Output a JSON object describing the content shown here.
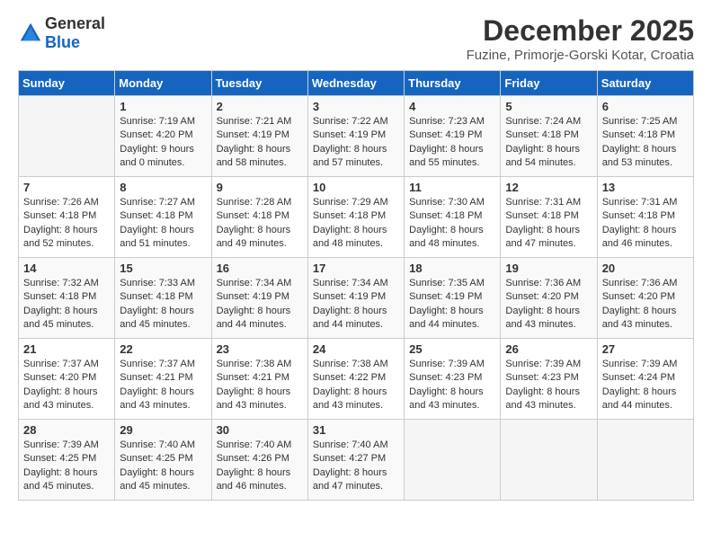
{
  "header": {
    "logo_general": "General",
    "logo_blue": "Blue",
    "title": "December 2025",
    "subtitle": "Fuzine, Primorje-Gorski Kotar, Croatia"
  },
  "calendar": {
    "days_of_week": [
      "Sunday",
      "Monday",
      "Tuesday",
      "Wednesday",
      "Thursday",
      "Friday",
      "Saturday"
    ],
    "weeks": [
      [
        {
          "day": "",
          "sunrise": "",
          "sunset": "",
          "daylight": ""
        },
        {
          "day": "1",
          "sunrise": "Sunrise: 7:19 AM",
          "sunset": "Sunset: 4:20 PM",
          "daylight": "Daylight: 9 hours and 0 minutes."
        },
        {
          "day": "2",
          "sunrise": "Sunrise: 7:21 AM",
          "sunset": "Sunset: 4:19 PM",
          "daylight": "Daylight: 8 hours and 58 minutes."
        },
        {
          "day": "3",
          "sunrise": "Sunrise: 7:22 AM",
          "sunset": "Sunset: 4:19 PM",
          "daylight": "Daylight: 8 hours and 57 minutes."
        },
        {
          "day": "4",
          "sunrise": "Sunrise: 7:23 AM",
          "sunset": "Sunset: 4:19 PM",
          "daylight": "Daylight: 8 hours and 55 minutes."
        },
        {
          "day": "5",
          "sunrise": "Sunrise: 7:24 AM",
          "sunset": "Sunset: 4:18 PM",
          "daylight": "Daylight: 8 hours and 54 minutes."
        },
        {
          "day": "6",
          "sunrise": "Sunrise: 7:25 AM",
          "sunset": "Sunset: 4:18 PM",
          "daylight": "Daylight: 8 hours and 53 minutes."
        }
      ],
      [
        {
          "day": "7",
          "sunrise": "Sunrise: 7:26 AM",
          "sunset": "Sunset: 4:18 PM",
          "daylight": "Daylight: 8 hours and 52 minutes."
        },
        {
          "day": "8",
          "sunrise": "Sunrise: 7:27 AM",
          "sunset": "Sunset: 4:18 PM",
          "daylight": "Daylight: 8 hours and 51 minutes."
        },
        {
          "day": "9",
          "sunrise": "Sunrise: 7:28 AM",
          "sunset": "Sunset: 4:18 PM",
          "daylight": "Daylight: 8 hours and 49 minutes."
        },
        {
          "day": "10",
          "sunrise": "Sunrise: 7:29 AM",
          "sunset": "Sunset: 4:18 PM",
          "daylight": "Daylight: 8 hours and 48 minutes."
        },
        {
          "day": "11",
          "sunrise": "Sunrise: 7:30 AM",
          "sunset": "Sunset: 4:18 PM",
          "daylight": "Daylight: 8 hours and 48 minutes."
        },
        {
          "day": "12",
          "sunrise": "Sunrise: 7:31 AM",
          "sunset": "Sunset: 4:18 PM",
          "daylight": "Daylight: 8 hours and 47 minutes."
        },
        {
          "day": "13",
          "sunrise": "Sunrise: 7:31 AM",
          "sunset": "Sunset: 4:18 PM",
          "daylight": "Daylight: 8 hours and 46 minutes."
        }
      ],
      [
        {
          "day": "14",
          "sunrise": "Sunrise: 7:32 AM",
          "sunset": "Sunset: 4:18 PM",
          "daylight": "Daylight: 8 hours and 45 minutes."
        },
        {
          "day": "15",
          "sunrise": "Sunrise: 7:33 AM",
          "sunset": "Sunset: 4:18 PM",
          "daylight": "Daylight: 8 hours and 45 minutes."
        },
        {
          "day": "16",
          "sunrise": "Sunrise: 7:34 AM",
          "sunset": "Sunset: 4:19 PM",
          "daylight": "Daylight: 8 hours and 44 minutes."
        },
        {
          "day": "17",
          "sunrise": "Sunrise: 7:34 AM",
          "sunset": "Sunset: 4:19 PM",
          "daylight": "Daylight: 8 hours and 44 minutes."
        },
        {
          "day": "18",
          "sunrise": "Sunrise: 7:35 AM",
          "sunset": "Sunset: 4:19 PM",
          "daylight": "Daylight: 8 hours and 44 minutes."
        },
        {
          "day": "19",
          "sunrise": "Sunrise: 7:36 AM",
          "sunset": "Sunset: 4:20 PM",
          "daylight": "Daylight: 8 hours and 43 minutes."
        },
        {
          "day": "20",
          "sunrise": "Sunrise: 7:36 AM",
          "sunset": "Sunset: 4:20 PM",
          "daylight": "Daylight: 8 hours and 43 minutes."
        }
      ],
      [
        {
          "day": "21",
          "sunrise": "Sunrise: 7:37 AM",
          "sunset": "Sunset: 4:20 PM",
          "daylight": "Daylight: 8 hours and 43 minutes."
        },
        {
          "day": "22",
          "sunrise": "Sunrise: 7:37 AM",
          "sunset": "Sunset: 4:21 PM",
          "daylight": "Daylight: 8 hours and 43 minutes."
        },
        {
          "day": "23",
          "sunrise": "Sunrise: 7:38 AM",
          "sunset": "Sunset: 4:21 PM",
          "daylight": "Daylight: 8 hours and 43 minutes."
        },
        {
          "day": "24",
          "sunrise": "Sunrise: 7:38 AM",
          "sunset": "Sunset: 4:22 PM",
          "daylight": "Daylight: 8 hours and 43 minutes."
        },
        {
          "day": "25",
          "sunrise": "Sunrise: 7:39 AM",
          "sunset": "Sunset: 4:23 PM",
          "daylight": "Daylight: 8 hours and 43 minutes."
        },
        {
          "day": "26",
          "sunrise": "Sunrise: 7:39 AM",
          "sunset": "Sunset: 4:23 PM",
          "daylight": "Daylight: 8 hours and 43 minutes."
        },
        {
          "day": "27",
          "sunrise": "Sunrise: 7:39 AM",
          "sunset": "Sunset: 4:24 PM",
          "daylight": "Daylight: 8 hours and 44 minutes."
        }
      ],
      [
        {
          "day": "28",
          "sunrise": "Sunrise: 7:39 AM",
          "sunset": "Sunset: 4:25 PM",
          "daylight": "Daylight: 8 hours and 45 minutes."
        },
        {
          "day": "29",
          "sunrise": "Sunrise: 7:40 AM",
          "sunset": "Sunset: 4:25 PM",
          "daylight": "Daylight: 8 hours and 45 minutes."
        },
        {
          "day": "30",
          "sunrise": "Sunrise: 7:40 AM",
          "sunset": "Sunset: 4:26 PM",
          "daylight": "Daylight: 8 hours and 46 minutes."
        },
        {
          "day": "31",
          "sunrise": "Sunrise: 7:40 AM",
          "sunset": "Sunset: 4:27 PM",
          "daylight": "Daylight: 8 hours and 47 minutes."
        },
        {
          "day": "",
          "sunrise": "",
          "sunset": "",
          "daylight": ""
        },
        {
          "day": "",
          "sunrise": "",
          "sunset": "",
          "daylight": ""
        },
        {
          "day": "",
          "sunrise": "",
          "sunset": "",
          "daylight": ""
        }
      ]
    ]
  }
}
